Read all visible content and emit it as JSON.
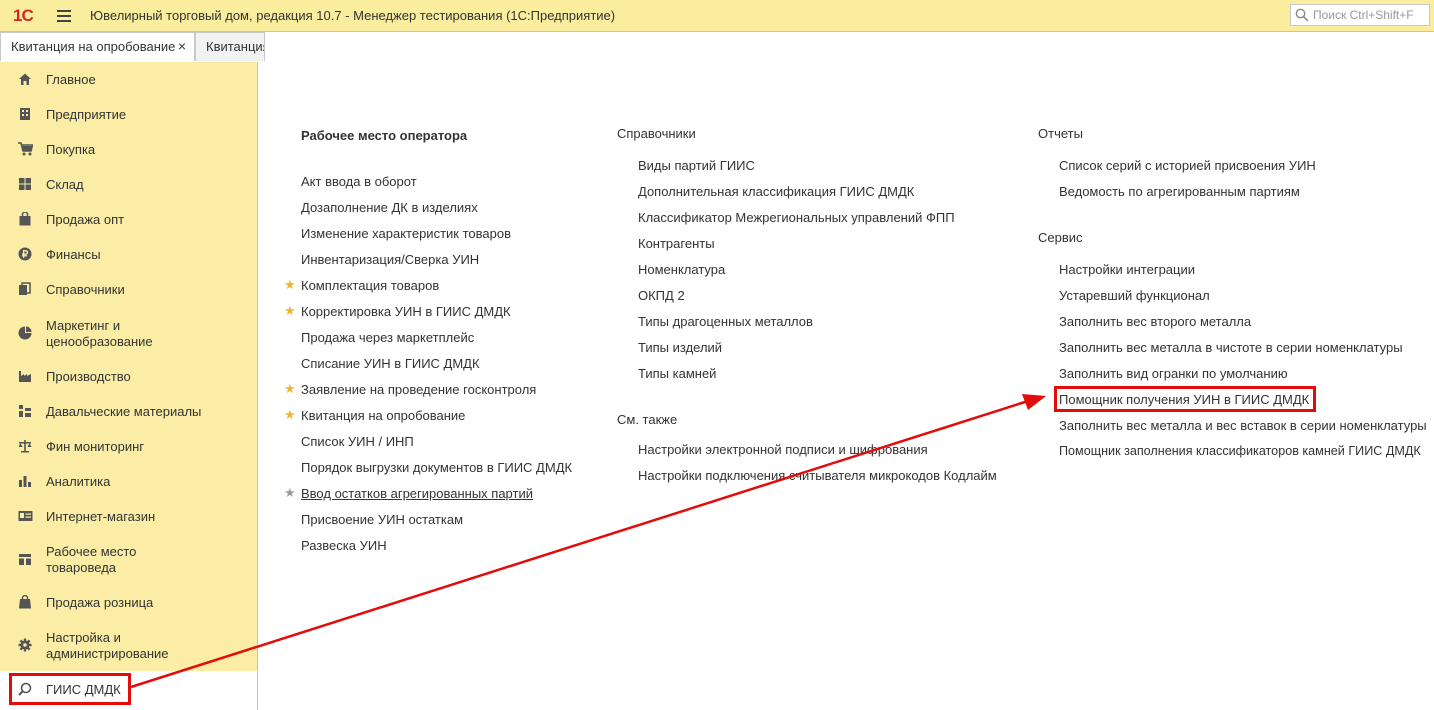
{
  "window": {
    "logo": "1С",
    "title": "Ювелирный торговый дом, редакция 10.7  - Менеджер тестирования (1С:Предприятие)",
    "search_placeholder": "Поиск Ctrl+Shift+F"
  },
  "tabs": [
    {
      "label": "Квитанция на опробование",
      "close": "×"
    },
    {
      "label": "Квитанция"
    }
  ],
  "sidebar": {
    "items": [
      {
        "label": "Главное",
        "icon": "home-icon"
      },
      {
        "label": "Предприятие",
        "icon": "building-icon"
      },
      {
        "label": "Покупка",
        "icon": "cart-icon"
      },
      {
        "label": "Склад",
        "icon": "warehouse-icon"
      },
      {
        "label": "Продажа опт",
        "icon": "bag-icon"
      },
      {
        "label": "Финансы",
        "icon": "ruble-icon"
      },
      {
        "label": "Справочники",
        "icon": "books-icon"
      },
      {
        "label": "Маркетинг и ценообразование",
        "icon": "pie-chart-icon"
      },
      {
        "label": "Производство",
        "icon": "factory-icon"
      },
      {
        "label": "Давальческие материалы",
        "icon": "materials-icon"
      },
      {
        "label": "Фин мониторинг",
        "icon": "scales-icon"
      },
      {
        "label": "Аналитика",
        "icon": "bar-chart-icon"
      },
      {
        "label": "Интернет-магазин",
        "icon": "id-card-icon"
      },
      {
        "label": "Рабочее место товароведа",
        "icon": "workplace-icon"
      },
      {
        "label": "Продажа розница",
        "icon": "shopping-bag-icon"
      },
      {
        "label": "Настройка и администрирование",
        "icon": "gear-icon"
      },
      {
        "label": "ГИИС ДМДК",
        "icon": "giis-icon"
      }
    ]
  },
  "main": {
    "operator": {
      "title": "Рабочее место оператора",
      "items": [
        {
          "label": "Акт ввода в оборот"
        },
        {
          "label": "Дозаполнение ДК в изделиях"
        },
        {
          "label": "Изменение характеристик товаров"
        },
        {
          "label": "Инвентаризация/Сверка УИН"
        },
        {
          "label": "Комплектация товаров",
          "star": "★"
        },
        {
          "label": "Корректировка УИН в ГИИС ДМДК",
          "star": "★"
        },
        {
          "label": "Продажа через маркетплейс"
        },
        {
          "label": "Списание УИН в ГИИС ДМДК"
        },
        {
          "label": "Заявление на проведение госконтроля",
          "star": "★"
        },
        {
          "label": "Квитанция на опробование",
          "star": "★"
        },
        {
          "label": "Список УИН / ИНП"
        },
        {
          "label": "Порядок выгрузки документов в ГИИС ДМДК"
        },
        {
          "label": "Ввод остатков агрегированных партий",
          "star": "★"
        },
        {
          "label": "Присвоение УИН остаткам"
        },
        {
          "label": "Развеска УИН"
        }
      ]
    },
    "references": {
      "title": "Справочники",
      "items": [
        "Виды партий ГИИС",
        "Дополнительная классификация ГИИС ДМДК",
        "Классификатор Межрегиональных управлений ФПП",
        "Контрагенты",
        "Номенклатура",
        "ОКПД 2",
        "Типы драгоценных металлов",
        "Типы изделий",
        "Типы камней"
      ]
    },
    "see_also": {
      "title": "См. также",
      "items": [
        "Настройки электронной подписи и шифрования",
        "Настройки подключения считывателя микрокодов Кодлайм"
      ]
    },
    "reports": {
      "title": "Отчеты",
      "items": [
        "Список серий с историей присвоения УИН",
        "Ведомость по агрегированным партиям"
      ]
    },
    "service": {
      "title": "Сервис",
      "items": [
        "Настройки интеграции",
        "Устаревший функционал",
        "Заполнить вес второго металла",
        "Заполнить вес металла в чистоте в серии номенклатуры",
        "Заполнить вид огранки по умолчанию",
        "Помощник получения УИН в ГИИС ДМДК",
        "Заполнить вес металла и вес вставок в серии номенклатуры",
        "Помощник заполнения классификаторов камней ГИИС ДМДК"
      ]
    }
  },
  "colors": {
    "topbar": "#fbed9e",
    "sidebar": "#fbeda5",
    "section_heading": "#2e9a47",
    "highlight": "#e40b0b",
    "star_active": "#f4b12a",
    "star_inactive": "#9b9b9b"
  }
}
